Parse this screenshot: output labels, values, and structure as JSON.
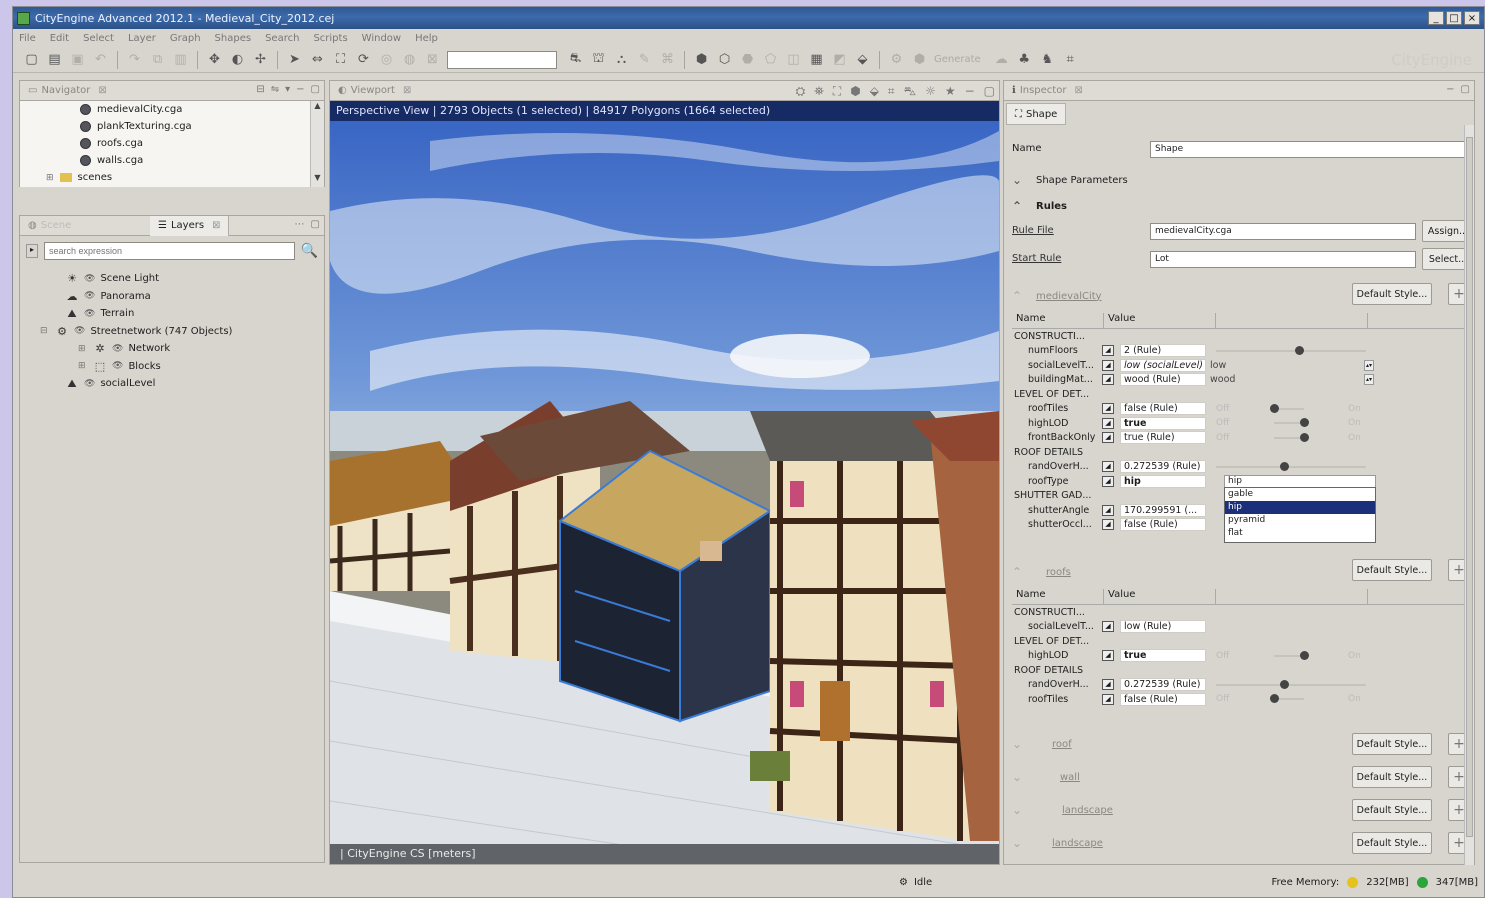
{
  "window": {
    "title": "CityEngine Advanced 2012.1 - Medieval_City_2012.cej",
    "controls": [
      "_",
      "□",
      "×"
    ]
  },
  "menu": [
    "File",
    "Edit",
    "Select",
    "Layer",
    "Graph",
    "Shapes",
    "Search",
    "Scripts",
    "Window",
    "Help"
  ],
  "toolbar": {
    "brand": "CityEngine",
    "sections": [
      {
        "kind": "file",
        "icons": [
          "new-icon",
          "open-icon",
          "save-icon",
          "undo-icon",
          "redo-icon"
        ]
      },
      {
        "kind": "navigate",
        "icons": [
          "move-icon",
          "rotate-icon",
          "scale-icon"
        ]
      },
      {
        "kind": "select",
        "icons": [
          "select-icon",
          "move-icon",
          "rotate-icon",
          "scale-icon",
          "snap-icon"
        ]
      },
      {
        "kind": "graph",
        "icons": [
          "street-icon",
          "block-icon",
          "shape-icon",
          "draw-icon"
        ]
      },
      {
        "kind": "generate",
        "icons": [
          "generate-icon",
          "regenerate-icon",
          "cleanup-icon",
          "subdivide-icon",
          "models-icon"
        ]
      }
    ],
    "generate_label": "Generate",
    "quick_search_value": ""
  },
  "navigator": {
    "tab": "Navigator",
    "files": [
      "medievalCity.cga",
      "plankTexturing.cga",
      "roofs.cga",
      "walls.cga",
      "scenes"
    ]
  },
  "scene": {
    "tabs": [
      "Scene",
      "Layers"
    ],
    "active_tab": "Layers",
    "search_placeholder": "search expression",
    "tree": [
      {
        "label": "Scene Light",
        "icon": "sun-icon",
        "level": 1
      },
      {
        "label": "Panorama",
        "icon": "cloud-icon",
        "level": 1
      },
      {
        "label": "Terrain",
        "icon": "terrain-icon",
        "level": 1
      },
      {
        "label": "Streetnetwork (747 Objects)",
        "icon": "network-icon",
        "level": 1,
        "expanded": true
      },
      {
        "label": "Network",
        "icon": "graph-icon",
        "level": 2
      },
      {
        "label": "Blocks",
        "icon": "block-icon",
        "level": 2
      },
      {
        "label": "socialLevel",
        "icon": "map-layer-icon",
        "level": 1
      }
    ]
  },
  "viewport": {
    "tab": "Viewport",
    "header": "Perspective View  |  2793 Objects  (1 selected)  |  84917 Polygons  (1664 selected)",
    "footer": "|  CityEngine CS [meters]"
  },
  "inspector": {
    "tab": "Inspector",
    "shape_tab": "Shape",
    "name_label": "Name",
    "name_value": "Shape",
    "shape_params": "Shape Parameters",
    "rules_label": "Rules",
    "rule_file_label": "Rule File",
    "rule_file_value": "medievalCity.cga",
    "assign_btn": "Assign...",
    "start_rule_label": "Start Rule",
    "start_rule_value": "Lot",
    "select_btn": "Select...",
    "default_style": "Default Style...",
    "col_name": "Name",
    "col_value": "Value",
    "sections": [
      {
        "title": "medievalCity",
        "rows": [
          {
            "type": "group",
            "label": "CONSTRUCTI..."
          },
          {
            "type": "attr",
            "name": "numFloors",
            "value": "2 (Rule)",
            "control": "slider",
            "knob": 0.55
          },
          {
            "type": "attr",
            "name": "socialLevelT...",
            "value": "low (socialLevel)",
            "extra": "low",
            "control": "spin",
            "italic": true
          },
          {
            "type": "attr",
            "name": "buildingMat...",
            "value": "wood (Rule)",
            "extra": "wood",
            "control": "spin"
          },
          {
            "type": "group",
            "label": "LEVEL OF DET..."
          },
          {
            "type": "attr",
            "name": "roofTiles",
            "value": "false (Rule)",
            "control": "toggle",
            "state": "off"
          },
          {
            "type": "attr",
            "name": "highLOD",
            "value": "true",
            "control": "toggle",
            "state": "on",
            "bold": true
          },
          {
            "type": "attr",
            "name": "frontBackOnly",
            "value": "true (Rule)",
            "control": "toggle",
            "state": "on"
          },
          {
            "type": "group",
            "label": "ROOF DETAILS"
          },
          {
            "type": "attr",
            "name": "randOverH...",
            "value": "0.272539 (Rule)",
            "control": "slider",
            "knob": 0.45
          },
          {
            "type": "attr",
            "name": "roofType",
            "value": "hip",
            "control": "combo",
            "bold": true,
            "combo_value": "hip"
          },
          {
            "type": "group",
            "label": "SHUTTER GAD..."
          },
          {
            "type": "attr",
            "name": "shutterAngle",
            "value": "170.299591 (..."
          },
          {
            "type": "attr",
            "name": "shutterOccl...",
            "value": "false (Rule)"
          }
        ]
      },
      {
        "title": "roofs",
        "rows": [
          {
            "type": "group",
            "label": "CONSTRUCTI..."
          },
          {
            "type": "attr",
            "name": "socialLevelT...",
            "value": "low (Rule)"
          },
          {
            "type": "group",
            "label": "LEVEL OF DET..."
          },
          {
            "type": "attr",
            "name": "highLOD",
            "value": "true",
            "control": "toggle",
            "state": "on",
            "bold": true
          },
          {
            "type": "group",
            "label": "ROOF DETAILS"
          },
          {
            "type": "attr",
            "name": "randOverH...",
            "value": "0.272539 (Rule)",
            "control": "slider",
            "knob": 0.45
          },
          {
            "type": "attr",
            "name": "roofTiles",
            "value": "false (Rule)",
            "control": "toggle",
            "state": "off"
          }
        ]
      }
    ],
    "dropdown_options": [
      "gable",
      "hip",
      "pyramid",
      "flat"
    ],
    "dropdown_selected": "hip",
    "off_label": "Off",
    "on_label": "On",
    "collapsed_sections": [
      "roof",
      "wall",
      "landscape",
      "landscape"
    ]
  },
  "status": {
    "idle": "Idle",
    "free_memory_label": "Free Memory:",
    "mem1": "232[MB]",
    "mem2": "347[MB]",
    "mem1_color": "#e7c21b",
    "mem2_color": "#2aa53a"
  }
}
